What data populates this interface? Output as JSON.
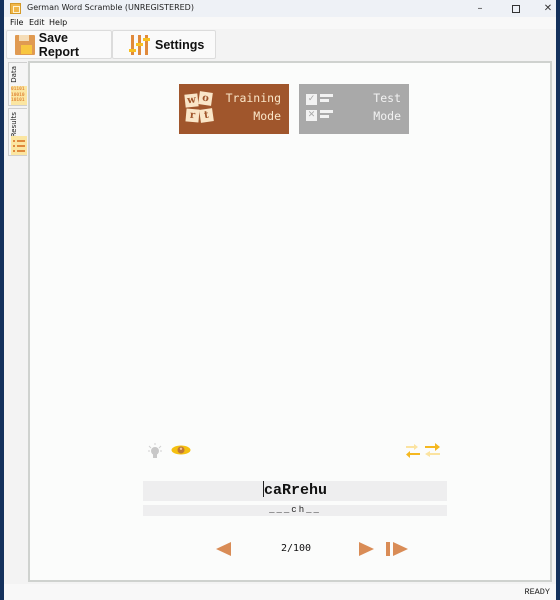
{
  "window": {
    "title": "German Word Scramble (UNREGISTERED)",
    "controls": {
      "minimize": "–",
      "close": "✕"
    }
  },
  "menu": {
    "items": [
      {
        "label": "File"
      },
      {
        "label": "Edit"
      },
      {
        "label": "Help"
      }
    ]
  },
  "toolbar": {
    "save_report": {
      "label": "Save Report",
      "icon": "floppy-disk-icon"
    },
    "settings": {
      "label": "Settings",
      "icon": "sliders-icon"
    }
  },
  "side_tabs": [
    {
      "label": "Data",
      "icon": "binary-data-icon",
      "binary": [
        "01101",
        "10010",
        "10101"
      ]
    },
    {
      "label": "Results",
      "icon": "list-icon"
    }
  ],
  "modes": {
    "training": {
      "line1": "Training",
      "line2": "Mode",
      "tiles": [
        "w",
        "o",
        "r",
        "t"
      ],
      "active": true
    },
    "test": {
      "line1": "Test",
      "line2": "Mode",
      "checks": [
        "✓",
        "✕"
      ],
      "active": false
    }
  },
  "tools": {
    "hint": "lightbulb-icon",
    "reveal": "eye-icon",
    "swap": "swap-arrows-icon"
  },
  "puzzle": {
    "scrambled_word": "caRrehu",
    "pattern": "___ch__"
  },
  "navigation": {
    "current": 2,
    "total": 100,
    "counter_text": "2/100"
  },
  "colors": {
    "accent_brown": "#a0562c",
    "nav_orange": "#d98c56",
    "highlight_yellow": "#f8c020",
    "test_gray": "#a9a9a9"
  },
  "status": {
    "text": "READY"
  }
}
